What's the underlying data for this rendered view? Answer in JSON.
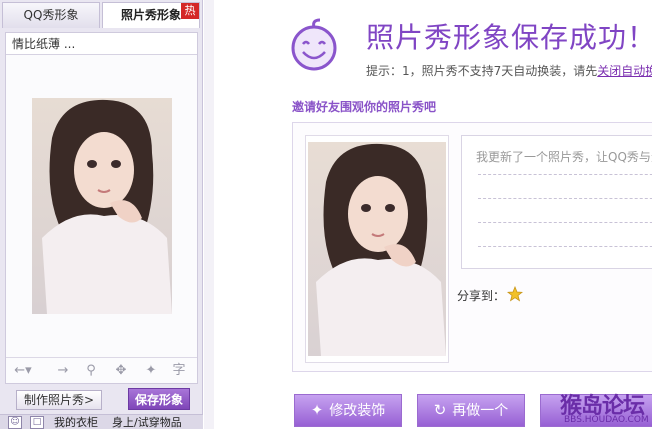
{
  "left": {
    "tabs": [
      {
        "label": "QQ秀形象"
      },
      {
        "label": "照片秀形象"
      }
    ],
    "hot_badge": "热",
    "dropdown_value": "情比纸薄 ...",
    "make_button": "制作照片秀>",
    "save_button": "保存形象",
    "bottom_links": [
      "我的衣柜",
      "身上/试穿物品"
    ]
  },
  "main": {
    "title": "照片秀形象保存成功！",
    "tip_prefix": "提示：1，照片秀不支持7天自动换装，请先",
    "tip_link": "关闭自动换装",
    "invite": "邀请好友围观你的照片秀吧",
    "share_text": "我更新了一个照片秀，让QQ秀与众",
    "share_label": "分享到：",
    "actions": [
      {
        "label": "修改装饰",
        "icon": "magic-wand-icon"
      },
      {
        "label": "再做一个",
        "icon": "refresh-icon"
      }
    ]
  },
  "watermark": {
    "main": "猴岛论坛",
    "url": "BBS.HOUDAO.COM"
  },
  "colors": {
    "accent": "#8045c4",
    "button": "#9760d4",
    "hot": "#d42727"
  }
}
